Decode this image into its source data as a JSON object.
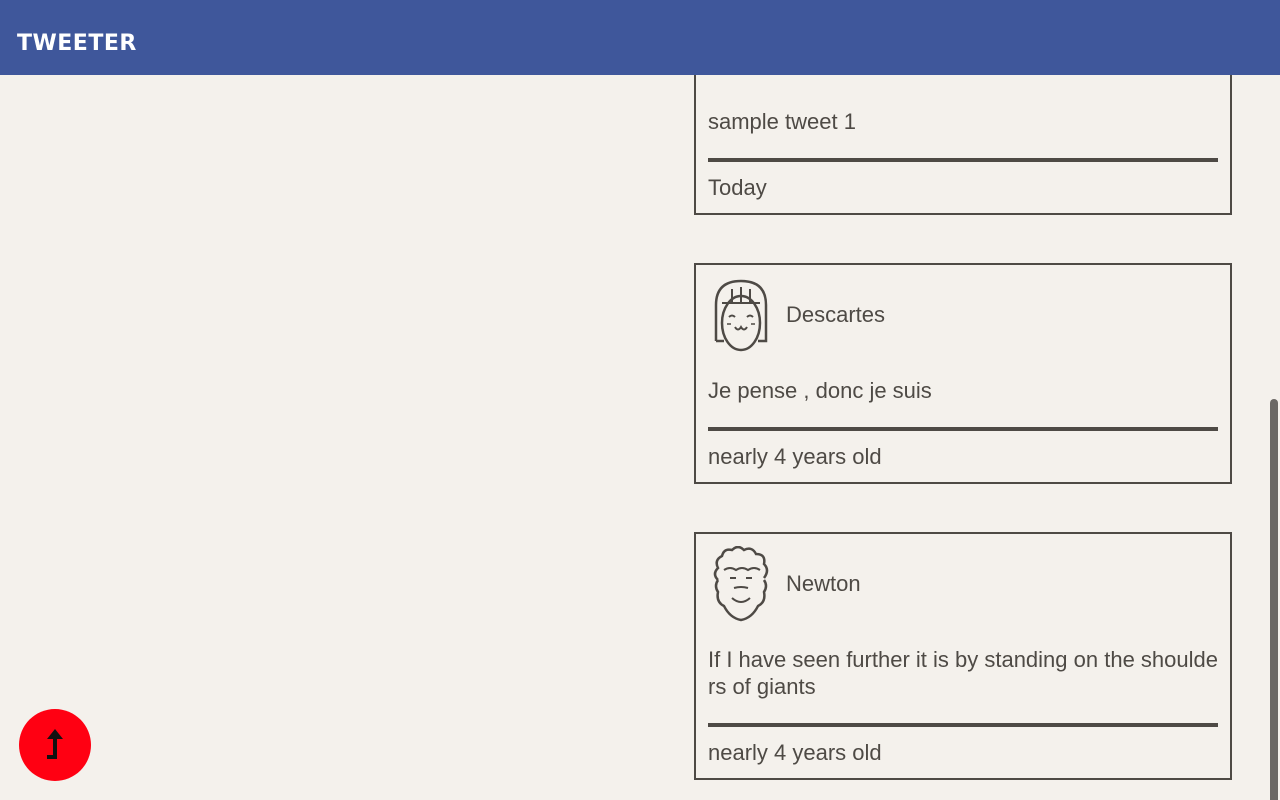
{
  "navbar": {
    "brand": "TWEETER"
  },
  "tweets": [
    {
      "author": "",
      "avatar": "cartoon-avatar-icon",
      "text": "sample tweet 1",
      "date": "Today"
    },
    {
      "author": "Descartes",
      "avatar": "girl-avatar-icon",
      "text": "Je pense , donc je suis",
      "date": "nearly 4 years old"
    },
    {
      "author": "Newton",
      "avatar": "curly-hair-avatar-icon",
      "text": "If I have seen further it is by standing on the shoulders of giants",
      "date": "nearly 4 years old"
    }
  ],
  "fab": {
    "icon": "arrow-up-icon"
  },
  "colors": {
    "navbar": "#3f579b",
    "background": "#f4f1ec",
    "text": "#4e4a45",
    "fab": "#ff0012"
  }
}
